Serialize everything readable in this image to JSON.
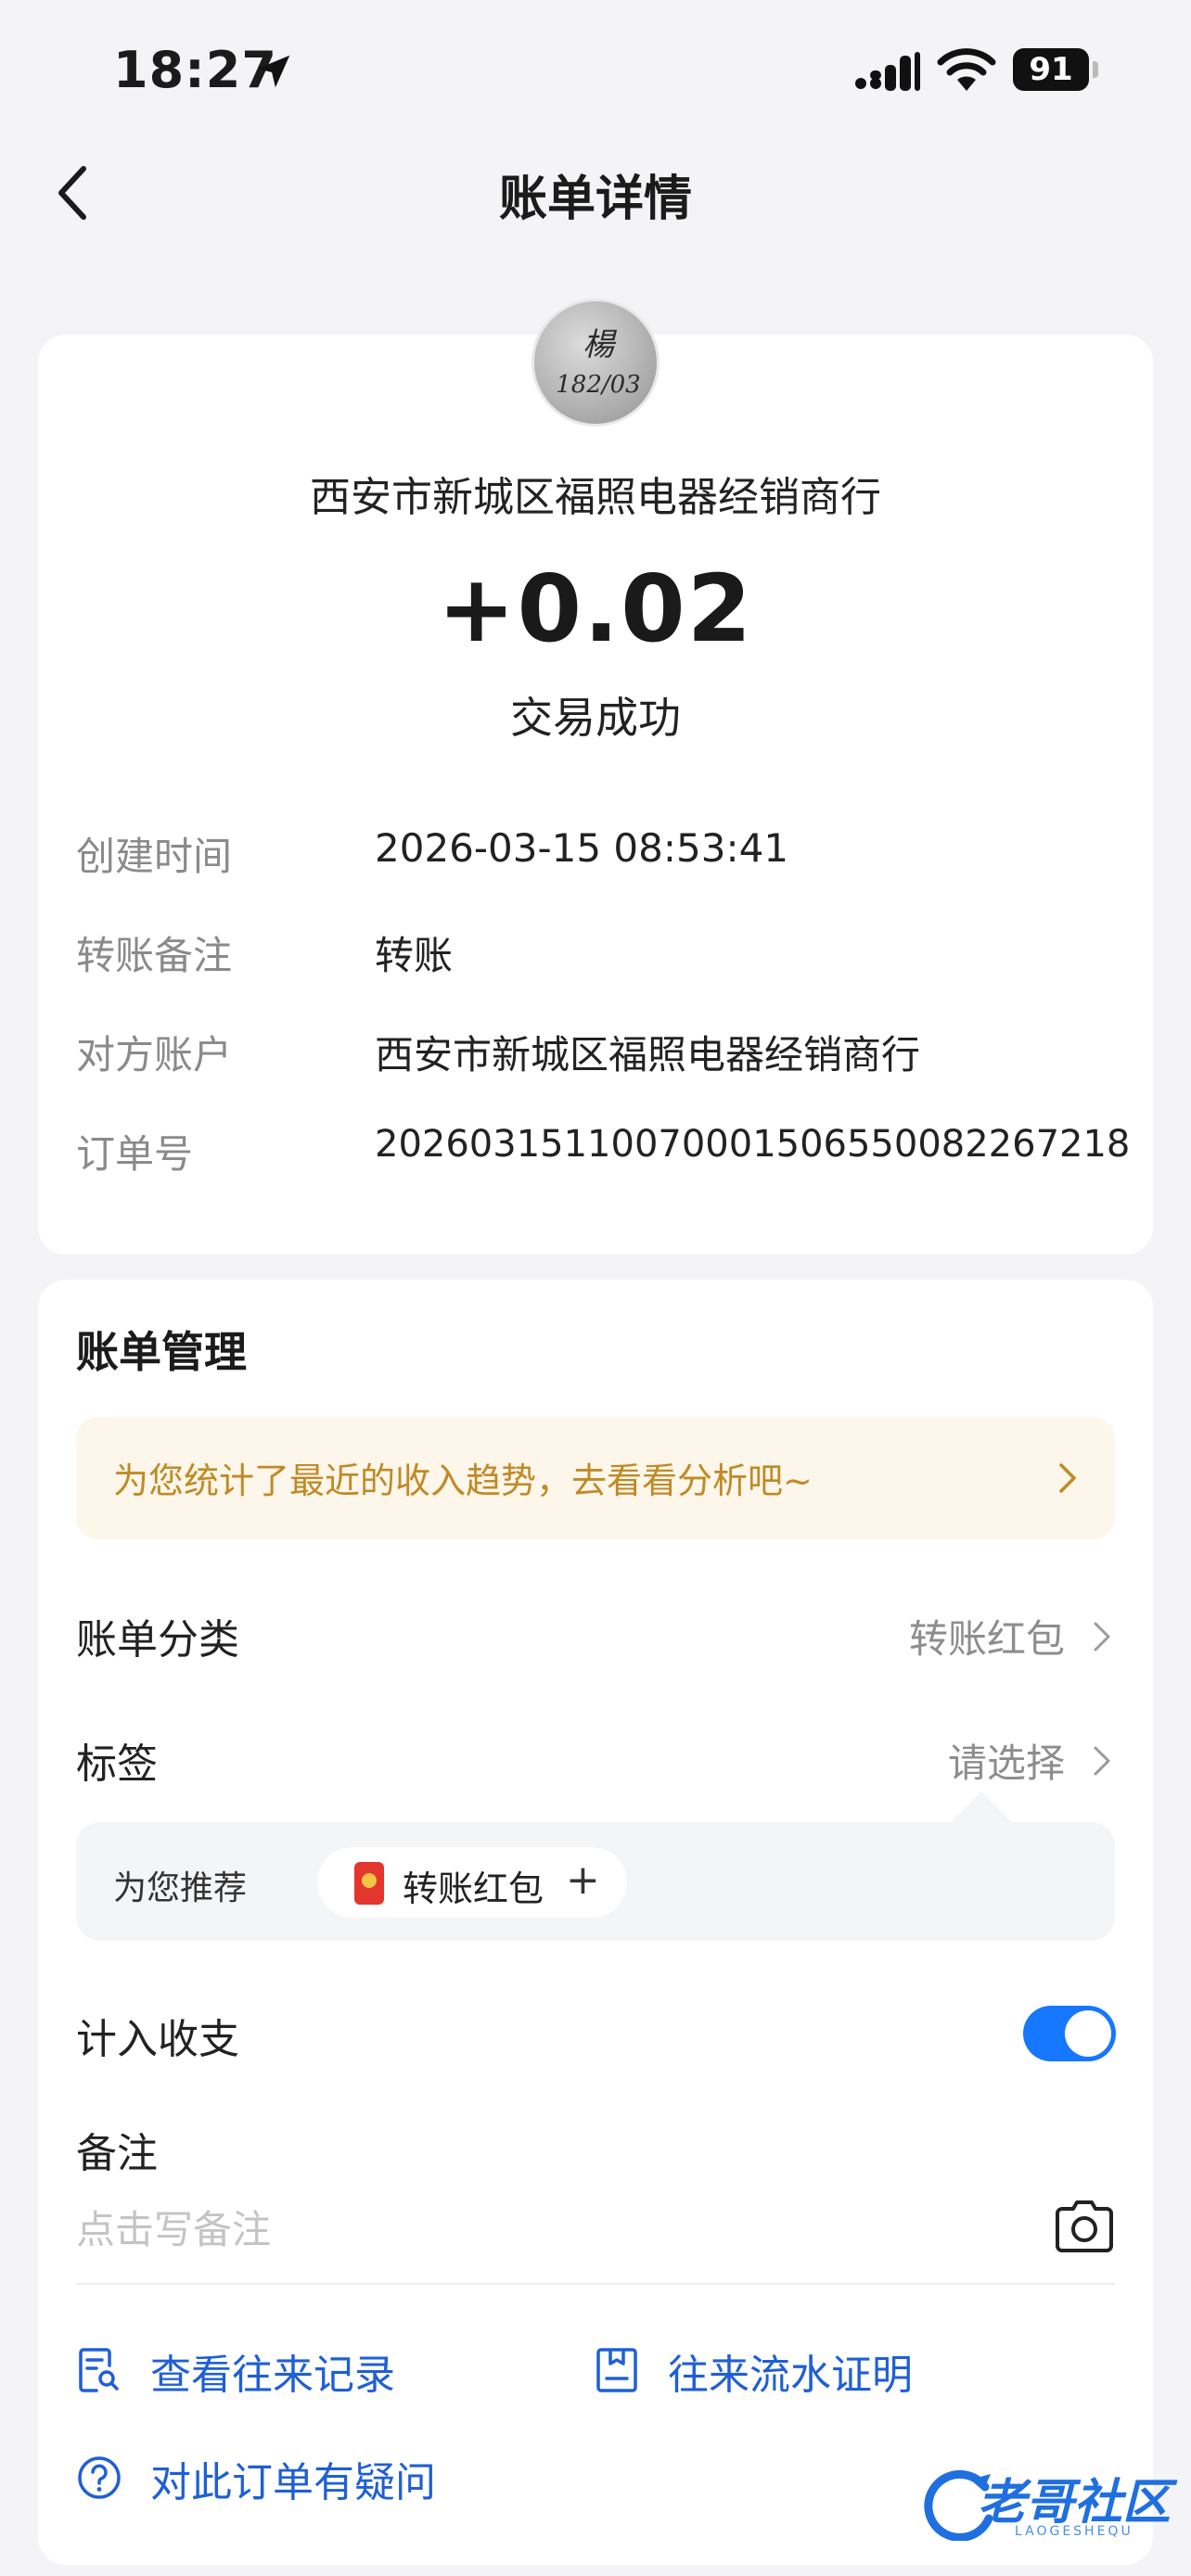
{
  "status_bar": {
    "time": "18:27",
    "battery": "91"
  },
  "nav": {
    "title": "账单详情"
  },
  "transaction": {
    "avatar_text_top": "楊",
    "avatar_text_bottom": "182/03",
    "merchant_name": "西安市新城区福照电器经销商行",
    "amount": "+0.02",
    "status": "交易成功",
    "details": [
      {
        "label": "创建时间",
        "value": "2026-03-15 08:53:41"
      },
      {
        "label": "转账备注",
        "value": "转账"
      },
      {
        "label": "对方账户",
        "value": "西安市新城区福照电器经销商行"
      },
      {
        "label": "订单号",
        "value": "20260315110070001506550082267218"
      }
    ]
  },
  "management": {
    "title": "账单管理",
    "trend_banner": "为您统计了最近的收入趋势，去看看分析吧~",
    "category": {
      "label": "账单分类",
      "value": "转账红包"
    },
    "tag": {
      "label": "标签",
      "value": "请选择"
    },
    "recommend": {
      "label": "为您推荐",
      "chip": "转账红包",
      "chip_action": "+"
    },
    "include_in_stats": {
      "label": "计入收支",
      "enabled": true
    },
    "note": {
      "label": "备注",
      "placeholder": "点击写备注"
    },
    "links": {
      "history": "查看往来记录",
      "proof": "往来流水证明",
      "question": "对此订单有疑问"
    }
  },
  "watermark": {
    "text": "老哥社区",
    "sub": "LAOGESHEQU"
  },
  "colors": {
    "accent": "#1677ff",
    "link": "#1f5fd6",
    "banner_text": "#c08a25",
    "banner_bg": "#fdf6ea"
  }
}
